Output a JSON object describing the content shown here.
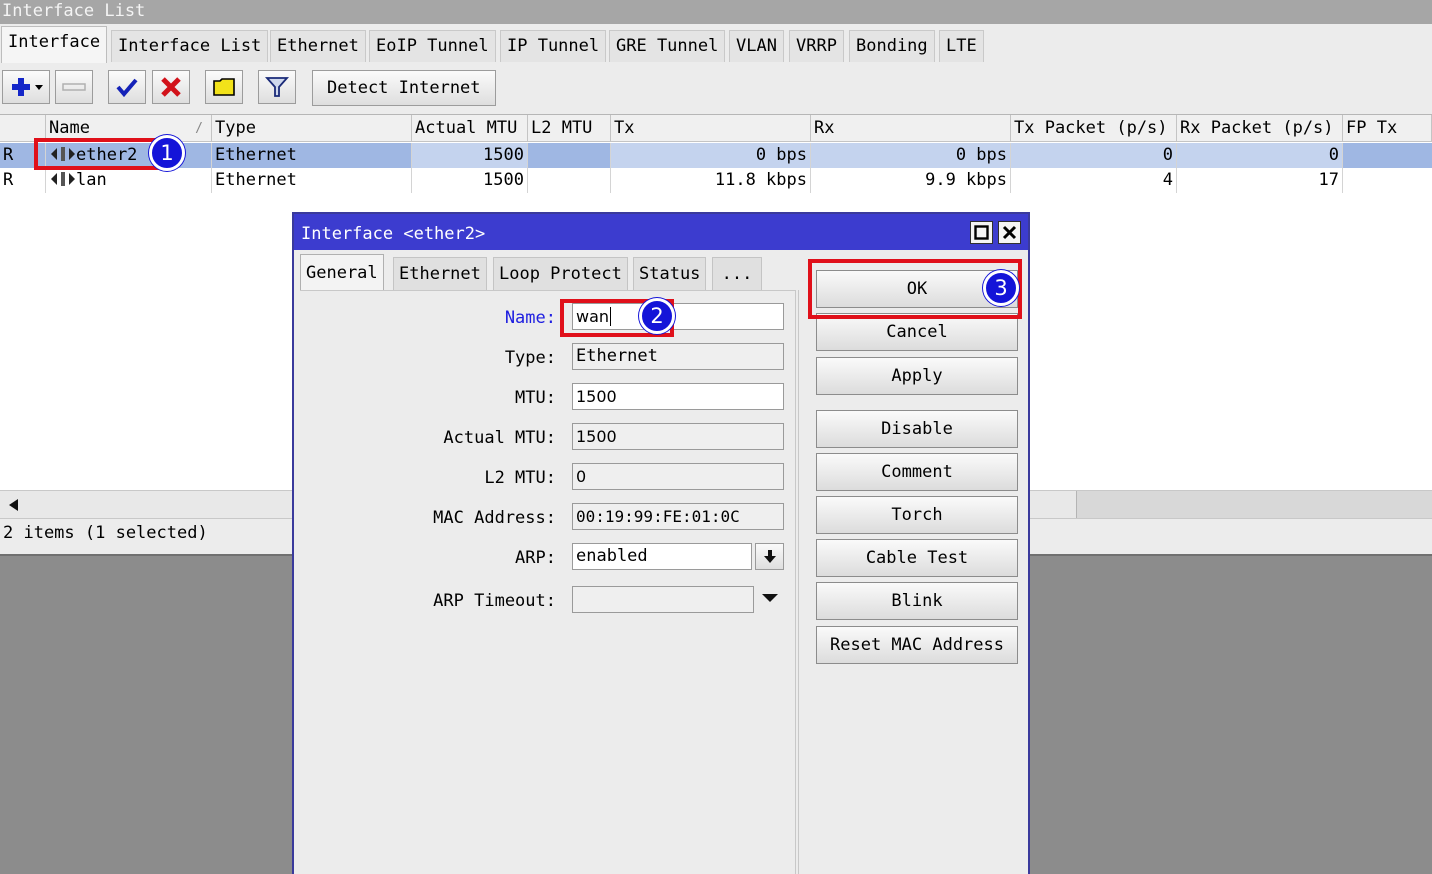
{
  "window": {
    "title": "Interface List"
  },
  "tabs": [
    "Interface",
    "Interface List",
    "Ethernet",
    "EoIP Tunnel",
    "IP Tunnel",
    "GRE Tunnel",
    "VLAN",
    "VRRP",
    "Bonding",
    "LTE"
  ],
  "toolbar": {
    "detect_label": "Detect Internet"
  },
  "table": {
    "columns": [
      "Name",
      "Type",
      "Actual MTU",
      "L2 MTU",
      "Tx",
      "Rx",
      "Tx Packet (p/s)",
      "Rx Packet (p/s)",
      "FP Tx"
    ],
    "sort_marker": "/",
    "rows": [
      {
        "flag": "R",
        "name": "ether2",
        "type": "Ethernet",
        "actual_mtu": "1500",
        "l2_mtu": "",
        "tx": "0 bps",
        "rx": "0 bps",
        "tx_pps": "0",
        "rx_pps": "0",
        "selected": true
      },
      {
        "flag": "R",
        "name": "lan",
        "type": "Ethernet",
        "actual_mtu": "1500",
        "l2_mtu": "",
        "tx": "11.8 kbps",
        "rx": "9.9 kbps",
        "tx_pps": "4",
        "rx_pps": "17",
        "selected": false
      }
    ]
  },
  "status": {
    "text": "2 items (1 selected)"
  },
  "dialog": {
    "title": "Interface <ether2>",
    "tabs": [
      "General",
      "Ethernet",
      "Loop Protect",
      "Status",
      "..."
    ],
    "fields": {
      "name_label": "Name:",
      "name_value": "wan",
      "type_label": "Type:",
      "type_value": "Ethernet",
      "mtu_label": "MTU:",
      "mtu_value": "1500",
      "actual_mtu_label": "Actual MTU:",
      "actual_mtu_value": "1500",
      "l2_mtu_label": "L2 MTU:",
      "l2_mtu_value": "0",
      "mac_label": "MAC Address:",
      "mac_value": "00:19:99:FE:01:0C",
      "arp_label": "ARP:",
      "arp_value": "enabled",
      "arp_timeout_label": "ARP Timeout:",
      "arp_timeout_value": ""
    },
    "buttons": {
      "ok": "OK",
      "cancel": "Cancel",
      "apply": "Apply",
      "disable": "Disable",
      "comment": "Comment",
      "torch": "Torch",
      "cable_test": "Cable Test",
      "blink": "Blink",
      "reset_mac": "Reset MAC Address"
    }
  },
  "annotations": [
    "1",
    "2",
    "3"
  ],
  "colors": {
    "highlight": "#e0101a",
    "badge": "#1414d8",
    "dialog_title": "#3c3ccf",
    "selection": "#9fb7e3"
  },
  "icons": [
    "add-icon",
    "dropdown-arrow-icon",
    "remove-icon",
    "enable-check-icon",
    "disable-x-icon",
    "comment-icon",
    "filter-icon",
    "ethernet-port-icon",
    "scroll-left-icon",
    "maximize-icon",
    "close-icon"
  ]
}
